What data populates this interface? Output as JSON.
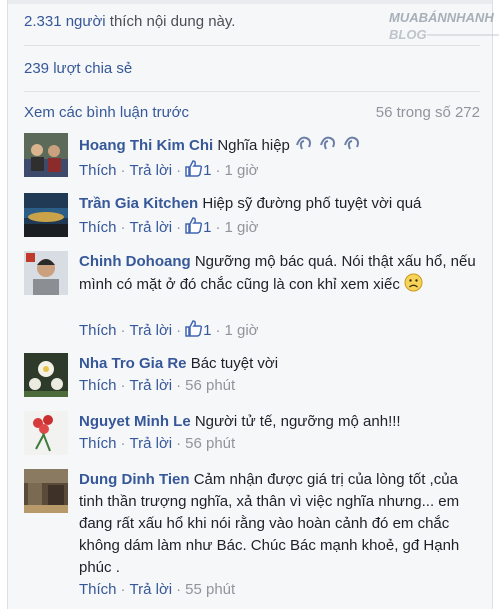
{
  "watermark": {
    "line1": "MUABÁNNHANH",
    "line2": "BLOG"
  },
  "summary": {
    "likes_count": "2.331",
    "likes_people": "người",
    "likes_text": "thích nội dung này.",
    "shares": "239 lượt chia sẻ"
  },
  "comments_header": {
    "view_previous": "Xem các bình luận trước",
    "count": "56 trong số 272"
  },
  "labels": {
    "like": "Thích",
    "reply": "Trả lời"
  },
  "comments": [
    {
      "author": "Hoang Thi Kim Chi",
      "text": "Nghĩa hiệp",
      "likes": "1",
      "time": "1 giờ"
    },
    {
      "author": "Trần Gia Kitchen",
      "text": "Hiệp sỹ đường phố tuyệt vời quá",
      "likes": "1",
      "time": "1 giờ"
    },
    {
      "author": "Chinh Dohoang",
      "text": "Ngưỡng mộ bác quá. Nói thật xấu hổ, nếu mình có mặt ở đó chắc cũng là con khỉ xem xiếc",
      "likes": "1",
      "time": "1 giờ"
    },
    {
      "author": "Nha Tro Gia Re",
      "text": "Bác tuyệt vời",
      "time": "56 phút"
    },
    {
      "author": "Nguyet Minh Le",
      "text": "Người tử tế, ngưỡng mộ anh!!!",
      "time": "56 phút"
    },
    {
      "author": "Dung Dinh Tien",
      "text": "Cảm nhận được giá trị của lòng tốt ,của tinh thần trượng nghĩa, xả thân vì việc nghĩa nhưng... em đang rất xấu hổ khi nói rằng vào hoàn cảnh đó em chắc không dám làm như Bác. Chúc Bác mạnh khoẻ, gđ Hạnh phúc .",
      "time": "55 phút"
    }
  ],
  "colors": {
    "link": "#365899",
    "meta": "#90949c",
    "text": "#1d2129",
    "background": "#f6f7f9"
  },
  "icons": [
    "like-thumb-icon",
    "clapping-hands-emoji-icon",
    "sad-face-emoji-icon"
  ]
}
